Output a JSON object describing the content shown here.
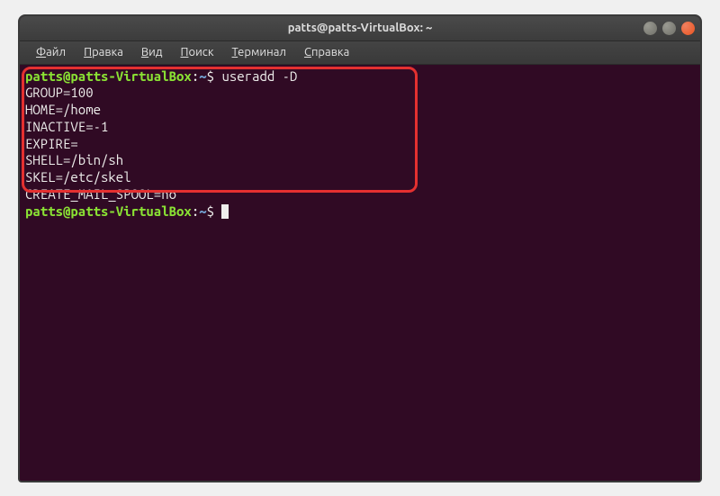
{
  "window": {
    "title": "patts@patts-VirtualBox: ~"
  },
  "menubar": {
    "items": [
      {
        "underline": "Ф",
        "rest": "айл"
      },
      {
        "underline": "П",
        "rest": "равка"
      },
      {
        "underline": "В",
        "rest": "ид"
      },
      {
        "underline": "П",
        "rest": "оиск"
      },
      {
        "underline": "Т",
        "rest": "ерминал"
      },
      {
        "underline": "С",
        "rest": "правка"
      }
    ]
  },
  "terminal": {
    "prompt_user": "patts@patts-VirtualBox",
    "prompt_sep": ":",
    "prompt_path": "~",
    "prompt_end": "$ ",
    "command": "useradd -D",
    "output": [
      "GROUP=100",
      "HOME=/home",
      "INACTIVE=-1",
      "EXPIRE=",
      "SHELL=/bin/sh",
      "SKEL=/etc/skel",
      "CREATE_MAIL_SPOOL=no"
    ]
  }
}
